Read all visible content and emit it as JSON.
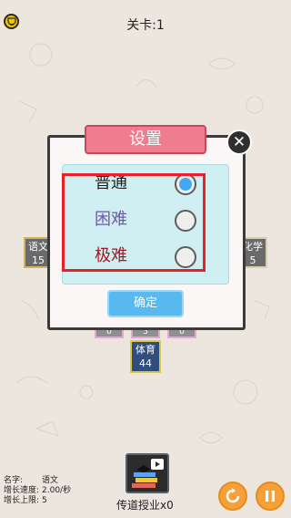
{
  "header": {
    "level_label": "关卡:1"
  },
  "board": {
    "tiles": [
      {
        "name": "语文",
        "value": "15"
      },
      {
        "name": "化学",
        "value": "5"
      },
      {
        "name": "体育",
        "value": "44"
      }
    ],
    "mini_values": [
      "0",
      "5",
      "0"
    ]
  },
  "settings_modal": {
    "title": "设置",
    "close_symbol": "✕",
    "options": [
      {
        "label": "普通",
        "selected": true,
        "color": "#1f1f1f"
      },
      {
        "label": "困难",
        "selected": false,
        "color": "#6c5aa6"
      },
      {
        "label": "极难",
        "selected": false,
        "color": "#a31622"
      }
    ],
    "confirm_label": "确定"
  },
  "bottom": {
    "info": [
      {
        "key": "名字:",
        "value": "语文"
      },
      {
        "key": "增长速度:",
        "value": "2.00/秒"
      },
      {
        "key": "增长上限:",
        "value": "5"
      }
    ],
    "teach_label": "传道授业x0"
  },
  "colors": {
    "modal_header": "#ef7d8d",
    "confirm": "#58b9f0",
    "accent_orange": "#f4a13c"
  }
}
